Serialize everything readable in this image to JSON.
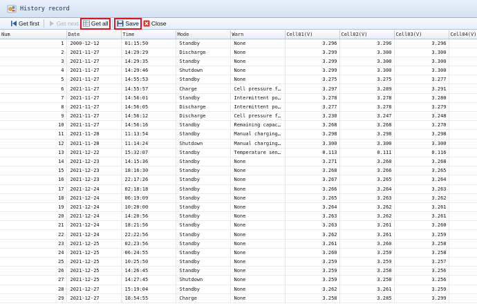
{
  "window": {
    "title": "History record",
    "title_icon": "gear-settings-icon"
  },
  "toolbar": {
    "buttons": [
      {
        "label": "Get first",
        "icon": "first-page-icon",
        "enabled": true
      },
      {
        "label": "Get next",
        "icon": "next-page-icon",
        "enabled": false
      },
      {
        "label": "Get all",
        "icon": "get-all-icon",
        "enabled": true,
        "highlighted": true
      },
      {
        "label": "Save",
        "icon": "save-icon",
        "enabled": true,
        "highlighted": true
      },
      {
        "label": "Close",
        "icon": "close-icon",
        "enabled": true
      }
    ],
    "highlight_color": "#e0121b"
  },
  "table": {
    "columns": [
      "Num",
      "Date",
      "Time",
      "Mode",
      "Warn",
      "Cell01(V)",
      "Cell02(V)",
      "Cell03(V)",
      "Cell04(V)"
    ],
    "rows": [
      [
        "1",
        "2000-12-12",
        "01:15:50",
        "Standby",
        "None",
        "3.296",
        "3.296",
        "3.296",
        ""
      ],
      [
        "2",
        "2021-11-27",
        "14:29:29",
        "Discharge",
        "None",
        "3.299",
        "3.300",
        "3.300",
        ""
      ],
      [
        "3",
        "2021-11-27",
        "14:29:35",
        "Standby",
        "None",
        "3.299",
        "3.300",
        "3.300",
        ""
      ],
      [
        "4",
        "2021-11-27",
        "14:29:46",
        "Shutdown",
        "None",
        "3.299",
        "3.300",
        "3.300",
        ""
      ],
      [
        "5",
        "2021-11-27",
        "14:55:53",
        "Standby",
        "None",
        "3.275",
        "3.275",
        "3.277",
        ""
      ],
      [
        "6",
        "2021-11-27",
        "14:55:57",
        "Charge",
        "Cell pressure f…",
        "3.297",
        "3.289",
        "3.291",
        ""
      ],
      [
        "7",
        "2021-11-27",
        "14:56:01",
        "Standby",
        "Intermittent po…",
        "3.278",
        "3.278",
        "3.280",
        ""
      ],
      [
        "8",
        "2021-11-27",
        "14:56:05",
        "Discharge",
        "Intermittent po…",
        "3.277",
        "3.278",
        "3.279",
        ""
      ],
      [
        "9",
        "2021-11-27",
        "14:56:12",
        "Discharge",
        "Cell pressure f…",
        "3.230",
        "3.247",
        "3.248",
        ""
      ],
      [
        "10",
        "2021-11-27",
        "14:56:16",
        "Standby",
        "Remaining capac…",
        "3.268",
        "3.268",
        "3.270",
        ""
      ],
      [
        "11",
        "2021-11-28",
        "11:13:54",
        "Standby",
        "Manual charging…",
        "3.298",
        "3.298",
        "3.298",
        ""
      ],
      [
        "12",
        "2021-11-28",
        "11:14:24",
        "Shutdown",
        "Manual charging…",
        "3.300",
        "3.300",
        "3.300",
        ""
      ],
      [
        "13",
        "2021-12-22",
        "15:32:07",
        "Standby",
        "Temperature sen…",
        "0.113",
        "0.111",
        "0.116",
        ""
      ],
      [
        "14",
        "2021-12-23",
        "14:15:36",
        "Standby",
        "None",
        "3.271",
        "3.268",
        "3.268",
        ""
      ],
      [
        "15",
        "2021-12-23",
        "18:16:30",
        "Standby",
        "None",
        "3.268",
        "3.266",
        "3.265",
        ""
      ],
      [
        "16",
        "2021-12-23",
        "22:17:26",
        "Standby",
        "None",
        "3.267",
        "3.265",
        "3.264",
        ""
      ],
      [
        "17",
        "2021-12-24",
        "02:18:18",
        "Standby",
        "None",
        "3.266",
        "3.264",
        "3.263",
        ""
      ],
      [
        "18",
        "2021-12-24",
        "06:19:09",
        "Standby",
        "None",
        "3.265",
        "3.263",
        "3.262",
        ""
      ],
      [
        "19",
        "2021-12-24",
        "10:20:00",
        "Standby",
        "None",
        "3.264",
        "3.262",
        "3.261",
        ""
      ],
      [
        "20",
        "2021-12-24",
        "14:20:56",
        "Standby",
        "None",
        "3.263",
        "3.262",
        "3.261",
        ""
      ],
      [
        "21",
        "2021-12-24",
        "18:21:56",
        "Standby",
        "None",
        "3.263",
        "3.261",
        "3.260",
        ""
      ],
      [
        "22",
        "2021-12-24",
        "22:22:56",
        "Standby",
        "None",
        "3.262",
        "3.261",
        "3.259",
        ""
      ],
      [
        "23",
        "2021-12-25",
        "02:23:56",
        "Standby",
        "None",
        "3.261",
        "3.260",
        "3.258",
        ""
      ],
      [
        "24",
        "2021-12-25",
        "06:24:55",
        "Standby",
        "None",
        "3.260",
        "3.259",
        "3.258",
        ""
      ],
      [
        "25",
        "2021-12-25",
        "10:25:50",
        "Standby",
        "None",
        "3.259",
        "3.259",
        "3.257",
        ""
      ],
      [
        "26",
        "2021-12-25",
        "14:26:45",
        "Standby",
        "None",
        "3.259",
        "3.258",
        "3.256",
        ""
      ],
      [
        "27",
        "2021-12-25",
        "14:27:45",
        "Shutdown",
        "None",
        "3.259",
        "3.258",
        "3.256",
        ""
      ],
      [
        "28",
        "2021-12-27",
        "15:19:04",
        "Standby",
        "None",
        "3.262",
        "3.261",
        "3.259",
        ""
      ],
      [
        "29",
        "2021-12-27",
        "18:54:55",
        "Charge",
        "None",
        "3.258",
        "3.285",
        "3.299",
        ""
      ]
    ]
  }
}
